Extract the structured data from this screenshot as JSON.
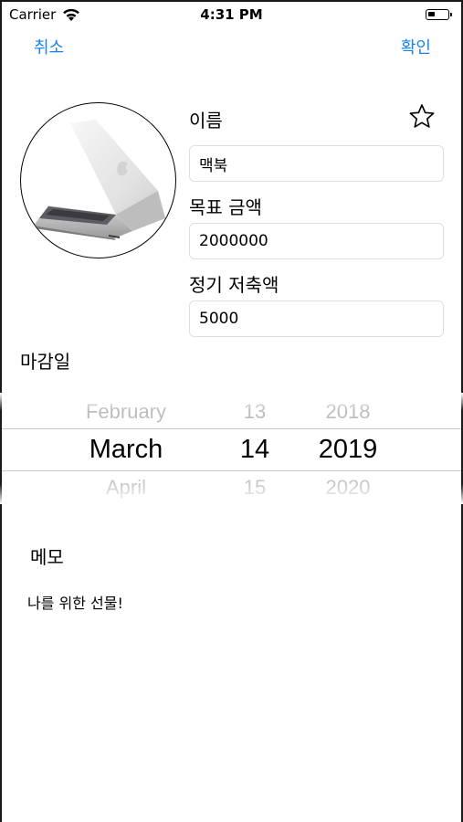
{
  "status_bar": {
    "carrier": "Carrier",
    "time": "4:31 PM",
    "battery_level": 0.35,
    "icons": [
      "wifi-icon",
      "battery-icon"
    ]
  },
  "nav": {
    "cancel_label": "취소",
    "confirm_label": "확인",
    "accent_color": "#1a82f0"
  },
  "form": {
    "photo_icon": "laptop-photo",
    "favorite_icon": "star-outline-icon",
    "name": {
      "label": "이름",
      "value": "맥북"
    },
    "goal_amount": {
      "label": "목표 금액",
      "value": "2000000"
    },
    "periodic_saving": {
      "label": "정기 저축액",
      "value": "5000"
    }
  },
  "deadline": {
    "label": "마감일",
    "month": {
      "prev": "February",
      "selected": "March",
      "next": "April"
    },
    "day": {
      "prev": "13",
      "selected": "14",
      "next": "15"
    },
    "year": {
      "prev": "2018",
      "selected": "2019",
      "next": "2020"
    }
  },
  "memo": {
    "label": "메모",
    "text": "나를 위한 선물!"
  }
}
